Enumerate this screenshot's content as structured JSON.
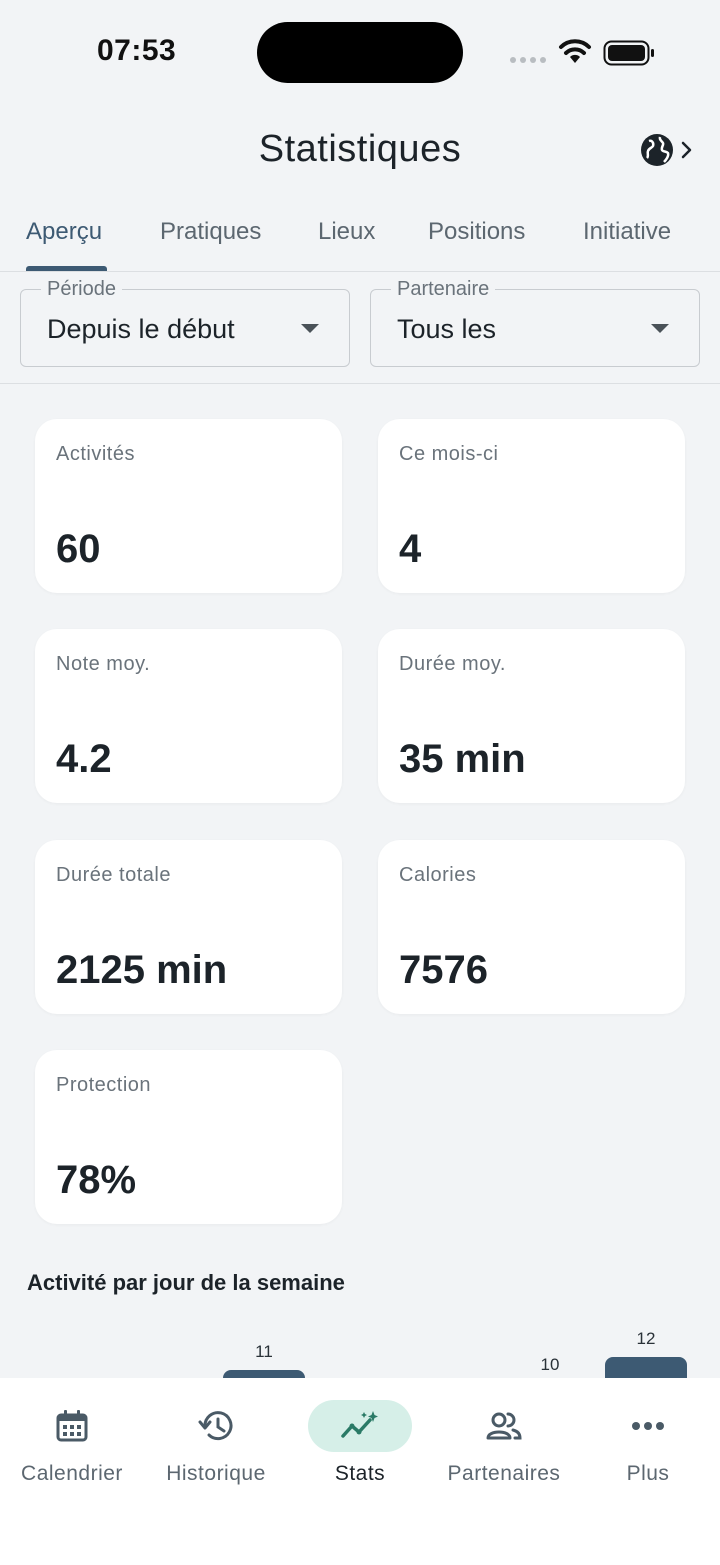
{
  "status_bar": {
    "time": "07:53"
  },
  "header": {
    "title": "Statistiques"
  },
  "tabs": [
    {
      "label": "Aperçu",
      "active": true
    },
    {
      "label": "Pratiques",
      "active": false
    },
    {
      "label": "Lieux",
      "active": false
    },
    {
      "label": "Positions",
      "active": false
    },
    {
      "label": "Initiative",
      "active": false
    }
  ],
  "filters": {
    "period": {
      "label": "Période",
      "value": "Depuis le début"
    },
    "partner": {
      "label": "Partenaire",
      "value": "Tous les"
    }
  },
  "stats": [
    {
      "label": "Activités",
      "value": "60"
    },
    {
      "label": "Ce mois-ci",
      "value": "4"
    },
    {
      "label": "Note moy.",
      "value": "4.2"
    },
    {
      "label": "Durée moy.",
      "value": "35 min"
    },
    {
      "label": "Durée totale",
      "value": "2125 min"
    },
    {
      "label": "Calories",
      "value": "7576"
    },
    {
      "label": "Protection",
      "value": "78%"
    }
  ],
  "weekday_section": {
    "title": "Activité par jour de la semaine"
  },
  "chart_data": {
    "type": "bar",
    "title": "Activité par jour de la semaine",
    "visible_values": [
      11,
      10,
      12
    ]
  },
  "nav": [
    {
      "label": "Calendrier",
      "icon": "calendar-icon",
      "active": false
    },
    {
      "label": "Historique",
      "icon": "history-icon",
      "active": false
    },
    {
      "label": "Stats",
      "icon": "stats-icon",
      "active": true
    },
    {
      "label": "Partenaires",
      "icon": "partners-icon",
      "active": false
    },
    {
      "label": "Plus",
      "icon": "more-icon",
      "active": false
    }
  ],
  "colors": {
    "accent": "#3d5a73",
    "active_nav_pill": "#d6efe8",
    "stats_icon": "#2a7a66",
    "background": "#f2f4f6"
  }
}
